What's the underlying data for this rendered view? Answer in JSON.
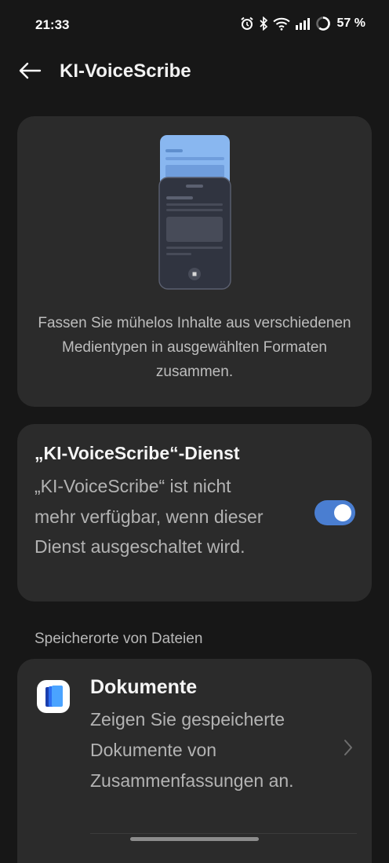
{
  "status_bar": {
    "time": "21:33",
    "battery": "57 %",
    "icons": [
      "alarm-icon",
      "bluetooth-icon",
      "wifi-icon",
      "signal-icon",
      "battery-icon"
    ]
  },
  "header": {
    "back_icon": "arrow-left-icon",
    "title": "KI-VoiceScribe"
  },
  "intro": {
    "description": "Fassen Sie mühelos Inhalte aus verschiedenen Medientypen in ausgewählten Formaten zusammen."
  },
  "service": {
    "title": "„KI-VoiceScribe“-Dienst",
    "description": "„KI-VoiceScribe“ ist nicht mehr verfügbar, wenn dieser Dienst ausgeschaltet wird.",
    "toggle_on": true
  },
  "storage": {
    "heading": "Speicherorte von Dateien",
    "items": [
      {
        "title": "Dokumente",
        "description": "Zeigen Sie gespeicherte Dokumente von Zusammenfassungen an.",
        "icon": "documents-app-icon"
      }
    ]
  },
  "colors": {
    "background": "#171717",
    "card": "#2b2b2b",
    "accent": "#4a7ed1"
  }
}
